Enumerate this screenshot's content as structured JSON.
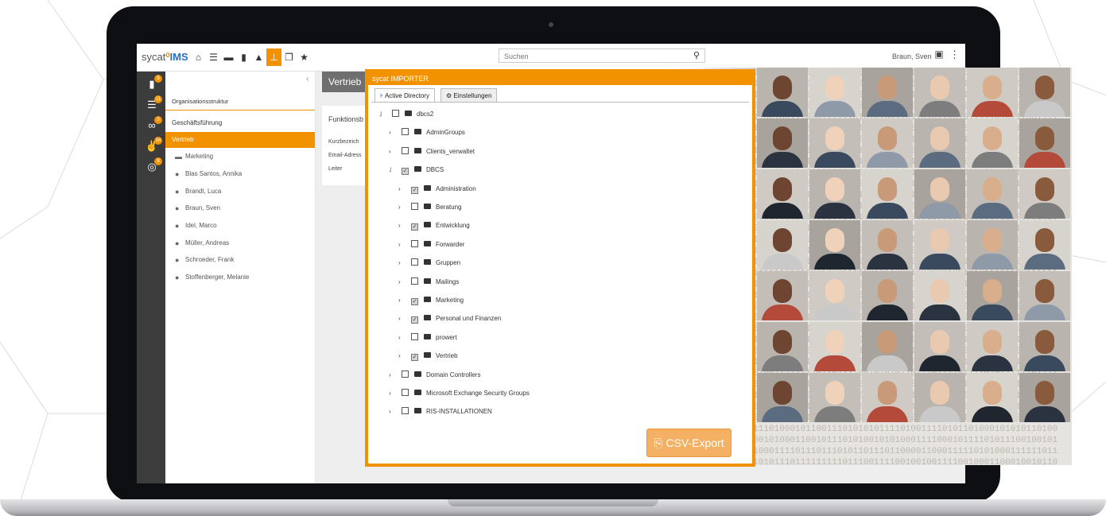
{
  "app": {
    "logo_prefix": "sycat",
    "logo_suffix": "IMS"
  },
  "topbar": {
    "icons": [
      "home-icon",
      "list-icon",
      "layers-icon",
      "document-icon",
      "graduation-cap-icon",
      "org-chart-icon",
      "copy-icon",
      "star-icon"
    ],
    "active_icon": "org-chart-icon",
    "search_placeholder": "Suchen",
    "user_name": "Braun, Sven"
  },
  "rail": {
    "badges": [
      "9",
      "11",
      "0",
      "34",
      "8"
    ]
  },
  "sidebar": {
    "section_title": "Organisationsstruktur",
    "items": [
      {
        "label": "Geschäftsführung",
        "type": "heading"
      },
      {
        "label": "Vertrieb",
        "type": "selected"
      },
      {
        "label": "Marketing",
        "type": "sub"
      },
      {
        "label": "Blas Santos, Annika",
        "type": "person"
      },
      {
        "label": "Brandt, Luca",
        "type": "person"
      },
      {
        "label": "Braun, Sven",
        "type": "person"
      },
      {
        "label": "Idel, Marco",
        "type": "person"
      },
      {
        "label": "Müller, Andreas",
        "type": "person"
      },
      {
        "label": "Schroeder, Frank",
        "type": "person"
      },
      {
        "label": "Stoffenberger, Melanie",
        "type": "person"
      }
    ]
  },
  "detail": {
    "title": "Vertrieb",
    "card_title": "Funktionsb",
    "fields": [
      "Kurzbezeich",
      "Email-Adress",
      "Leiter"
    ]
  },
  "importer": {
    "title": "sycat IMPORTER",
    "tabs": [
      "Active Directory",
      "Einstellungen"
    ],
    "tree": [
      {
        "label": "dbcs2",
        "level": 0,
        "expanded": true,
        "checked": false
      },
      {
        "label": "AdminGroups",
        "level": 1,
        "expanded": false,
        "checked": false
      },
      {
        "label": "Clients_verwaltet",
        "level": 1,
        "expanded": false,
        "checked": false
      },
      {
        "label": "DBCS",
        "level": 1,
        "expanded": true,
        "checked": true
      },
      {
        "label": "Administration",
        "level": 2,
        "expanded": false,
        "checked": true
      },
      {
        "label": "Beratung",
        "level": 2,
        "expanded": false,
        "checked": false
      },
      {
        "label": "Entwicklung",
        "level": 2,
        "expanded": false,
        "checked": true
      },
      {
        "label": "Forwarder",
        "level": 2,
        "expanded": false,
        "checked": false
      },
      {
        "label": "Gruppen",
        "level": 2,
        "expanded": false,
        "checked": false
      },
      {
        "label": "Mailings",
        "level": 2,
        "expanded": false,
        "checked": false
      },
      {
        "label": "Marketing",
        "level": 2,
        "expanded": false,
        "checked": true
      },
      {
        "label": "Personal und Finanzen",
        "level": 2,
        "expanded": false,
        "checked": true
      },
      {
        "label": "prowert",
        "level": 2,
        "expanded": false,
        "checked": false
      },
      {
        "label": "Vertrieb",
        "level": 2,
        "expanded": false,
        "checked": true
      },
      {
        "label": "Domain Controllers",
        "level": 1,
        "expanded": false,
        "checked": false
      },
      {
        "label": "Microsoft Exchange Security Groups",
        "level": 1,
        "expanded": false,
        "checked": false
      },
      {
        "label": "RIS-INSTALLATIONEN",
        "level": 1,
        "expanded": false,
        "checked": false
      }
    ],
    "export_button": "CSV-Export"
  },
  "colors": {
    "accent": "#f39200",
    "rail": "#3c3c3c",
    "frame": "#0e0f12"
  }
}
